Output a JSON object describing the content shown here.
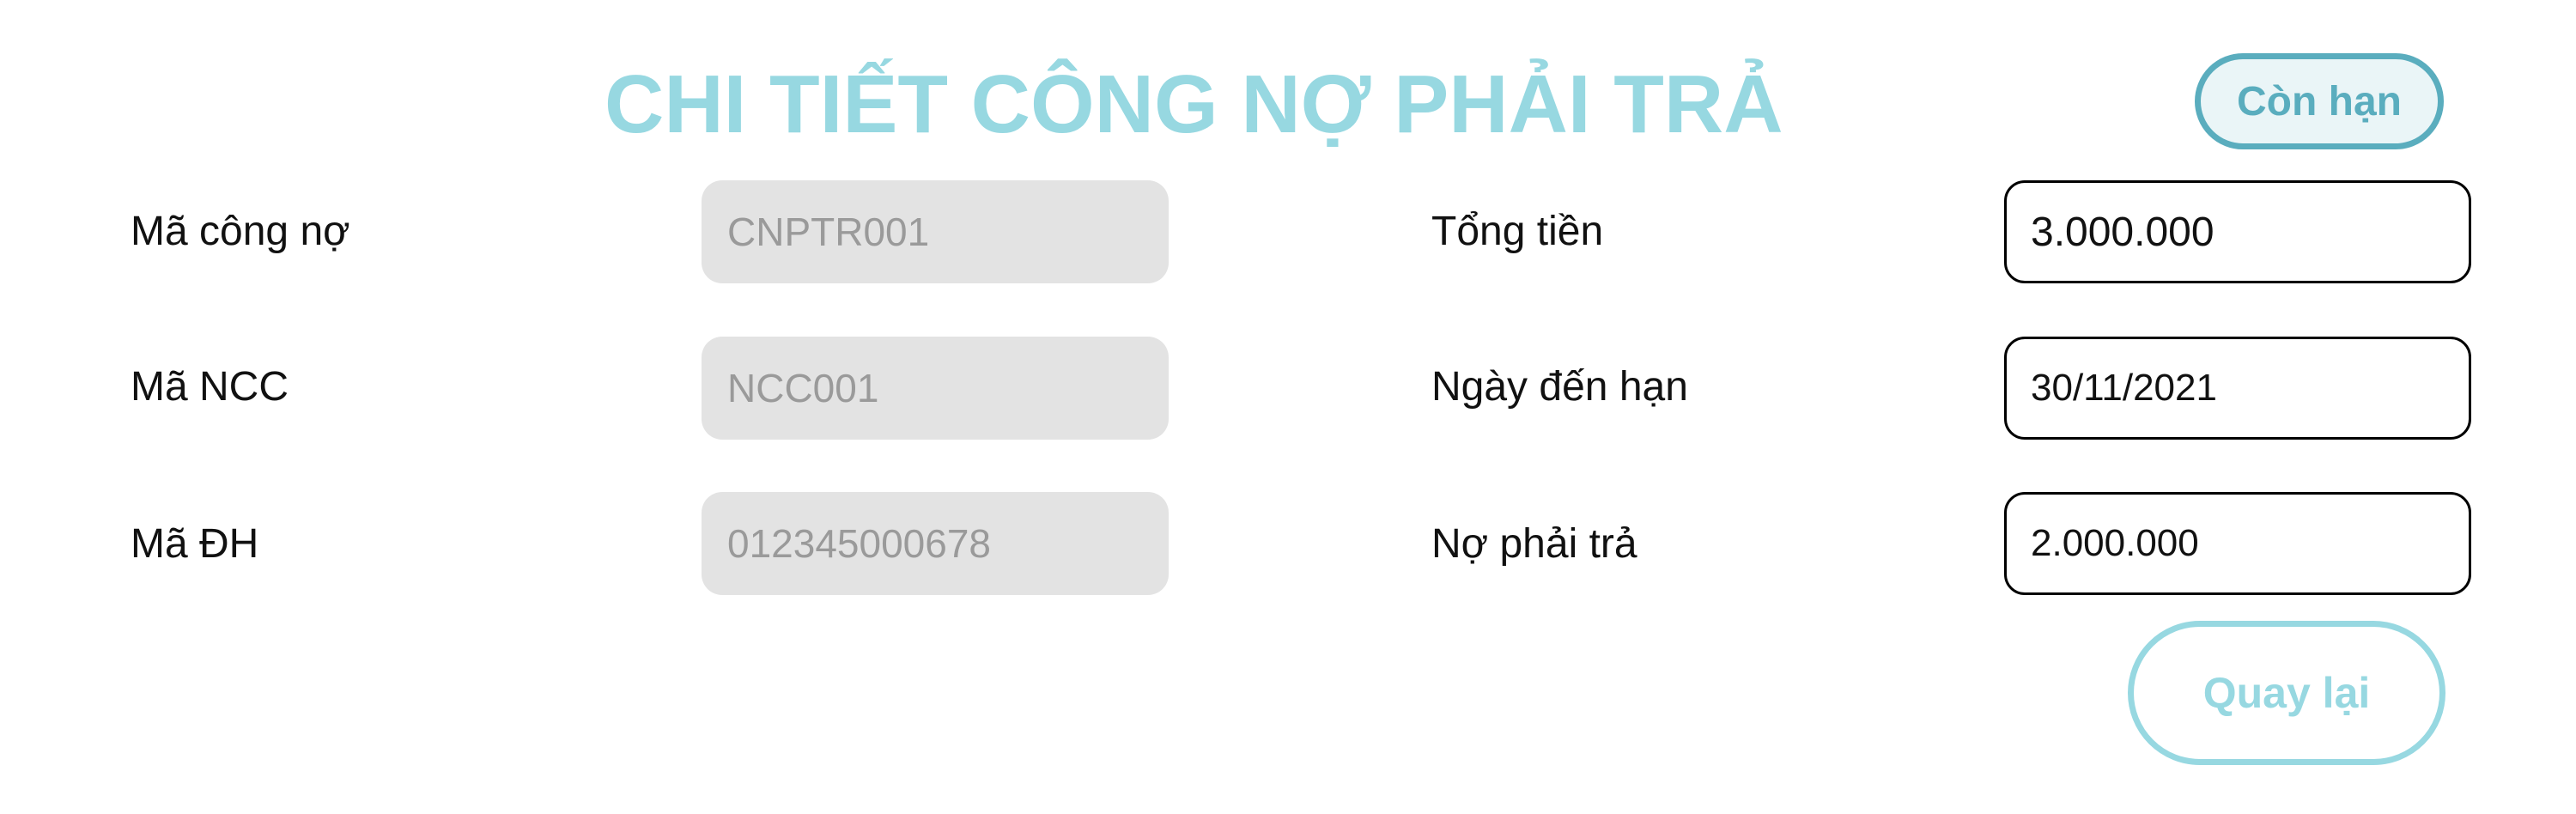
{
  "header": {
    "title": "CHI TIẾT CÔNG NỢ PHẢI TRẢ",
    "status_badge": "Còn hạn"
  },
  "form": {
    "left": [
      {
        "label": "Mã công nợ",
        "value": "CNPTR001"
      },
      {
        "label": "Mã NCC",
        "value": "NCC001"
      },
      {
        "label": "Mã ĐH",
        "value": "012345000678"
      }
    ],
    "right": [
      {
        "label": "Tổng tiền",
        "value": "3.000.000"
      },
      {
        "label": "Ngày đến hạn",
        "value": "30/11/2021"
      },
      {
        "label": "Nợ phải trả",
        "value": "2.000.000"
      }
    ]
  },
  "actions": {
    "back_label": "Quay lại"
  },
  "colors": {
    "title": "#97d8e1",
    "badge_border": "#5aadbe",
    "badge_bg": "#eaf5f7",
    "readonly_bg": "#e3e3e3",
    "readonly_text": "#9a9a9a",
    "back_button": "#97d8e1"
  }
}
